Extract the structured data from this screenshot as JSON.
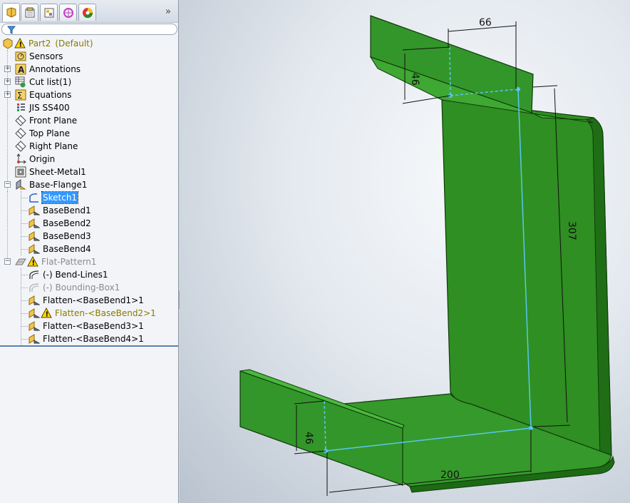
{
  "feature_tree": {
    "part": {
      "name": "Part2",
      "config": "(Default)"
    },
    "items": [
      {
        "label": "Sensors",
        "icon": "sensors-icon"
      },
      {
        "label": "Annotations",
        "icon": "annotations-icon"
      },
      {
        "label": "Cut list(1)",
        "icon": "cut-list-icon"
      },
      {
        "label": "Equations",
        "icon": "equations-icon"
      },
      {
        "label": "JIS SS400",
        "icon": "material-icon"
      },
      {
        "label": "Front Plane",
        "icon": "plane-icon"
      },
      {
        "label": "Top Plane",
        "icon": "plane-icon"
      },
      {
        "label": "Right Plane",
        "icon": "plane-icon"
      },
      {
        "label": "Origin",
        "icon": "origin-icon"
      },
      {
        "label": "Sheet-Metal1",
        "icon": "sheet-metal-icon"
      },
      {
        "label": "Base-Flange1",
        "icon": "base-flange-icon"
      },
      {
        "label": "Sketch1",
        "icon": "sketch-icon"
      },
      {
        "label": "BaseBend1",
        "icon": "bend-icon"
      },
      {
        "label": "BaseBend2",
        "icon": "bend-icon"
      },
      {
        "label": "BaseBend3",
        "icon": "bend-icon"
      },
      {
        "label": "BaseBend4",
        "icon": "bend-icon"
      },
      {
        "label": "Flat-Pattern1",
        "icon": "flat-pattern-icon"
      },
      {
        "label": "(-) Bend-Lines1",
        "icon": "bend-lines-icon"
      },
      {
        "label": "(-) Bounding-Box1",
        "icon": "bounding-box-icon"
      },
      {
        "label": "Flatten-<BaseBend1>1",
        "icon": "flatten-icon"
      },
      {
        "label": "Flatten-<BaseBend2>1",
        "icon": "flatten-icon"
      },
      {
        "label": "Flatten-<BaseBend3>1",
        "icon": "flatten-icon"
      },
      {
        "label": "Flatten-<BaseBend4>1",
        "icon": "flatten-icon"
      }
    ]
  },
  "panel_tabs": [
    "feature-manager",
    "property-manager",
    "configuration-manager",
    "dimxpert-manager",
    "display-manager"
  ],
  "more_glyph": "»",
  "warning_glyph": "!",
  "dimensions": {
    "top_width": "66",
    "top_height": "46",
    "web_height": "307",
    "bottom_height": "46",
    "base_width": "200"
  },
  "colors": {
    "part_green": "#2d8a1e",
    "selection_blue": "#3399ff",
    "sketch_line": "#56c8f0"
  }
}
